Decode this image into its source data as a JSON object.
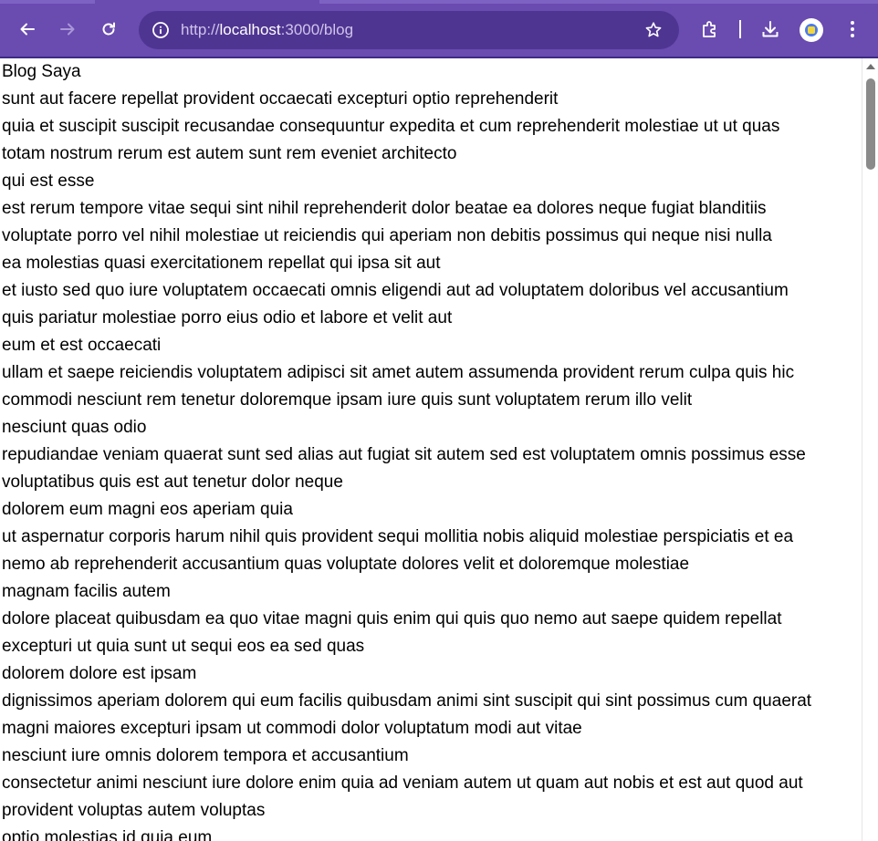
{
  "browser": {
    "url_scheme": "http://",
    "url_host": "localhost",
    "url_rest": ":3000/blog",
    "icons": {
      "back": "arrow-left-icon",
      "forward": "arrow-right-icon",
      "reload": "reload-icon",
      "site_info": "info-icon",
      "bookmark": "star-icon",
      "extensions": "puzzle-icon",
      "downloads": "download-icon",
      "profile": "profile-avatar-icon",
      "menu": "kebab-menu-icon"
    },
    "colors": {
      "toolbar": "#6a4bb0",
      "omnibox": "#4f3592"
    }
  },
  "page": {
    "heading": "Blog Saya",
    "lines": [
      "sunt aut facere repellat provident occaecati excepturi optio reprehenderit",
      "quia et suscipit suscipit recusandae consequuntur expedita et cum reprehenderit molestiae ut ut quas",
      "totam nostrum rerum est autem sunt rem eveniet architecto",
      "qui est esse",
      "est rerum tempore vitae sequi sint nihil reprehenderit dolor beatae ea dolores neque fugiat blanditiis",
      "voluptate porro vel nihil molestiae ut reiciendis qui aperiam non debitis possimus qui neque nisi nulla",
      "ea molestias quasi exercitationem repellat qui ipsa sit aut",
      "et iusto sed quo iure voluptatem occaecati omnis eligendi aut ad voluptatem doloribus vel accusantium",
      "quis pariatur molestiae porro eius odio et labore et velit aut",
      "eum et est occaecati",
      "ullam et saepe reiciendis voluptatem adipisci sit amet autem assumenda provident rerum culpa quis hic",
      "commodi nesciunt rem tenetur doloremque ipsam iure quis sunt voluptatem rerum illo velit",
      "nesciunt quas odio",
      "repudiandae veniam quaerat sunt sed alias aut fugiat sit autem sed est voluptatem omnis possimus esse",
      "voluptatibus quis est aut tenetur dolor neque",
      "dolorem eum magni eos aperiam quia",
      "ut aspernatur corporis harum nihil quis provident sequi mollitia nobis aliquid molestiae perspiciatis et ea",
      "nemo ab reprehenderit accusantium quas voluptate dolores velit et doloremque molestiae",
      "magnam facilis autem",
      "dolore placeat quibusdam ea quo vitae magni quis enim qui quis quo nemo aut saepe quidem repellat",
      "excepturi ut quia sunt ut sequi eos ea sed quas",
      "dolorem dolore est ipsam",
      "dignissimos aperiam dolorem qui eum facilis quibusdam animi sint suscipit qui sint possimus cum quaerat",
      "magni maiores excepturi ipsam ut commodi dolor voluptatum modi aut vitae",
      "nesciunt iure omnis dolorem tempora et accusantium",
      "consectetur animi nesciunt iure dolore enim quia ad veniam autem ut quam aut nobis et est aut quod aut",
      "provident voluptas autem voluptas",
      "optio molestias id quia eum"
    ]
  }
}
